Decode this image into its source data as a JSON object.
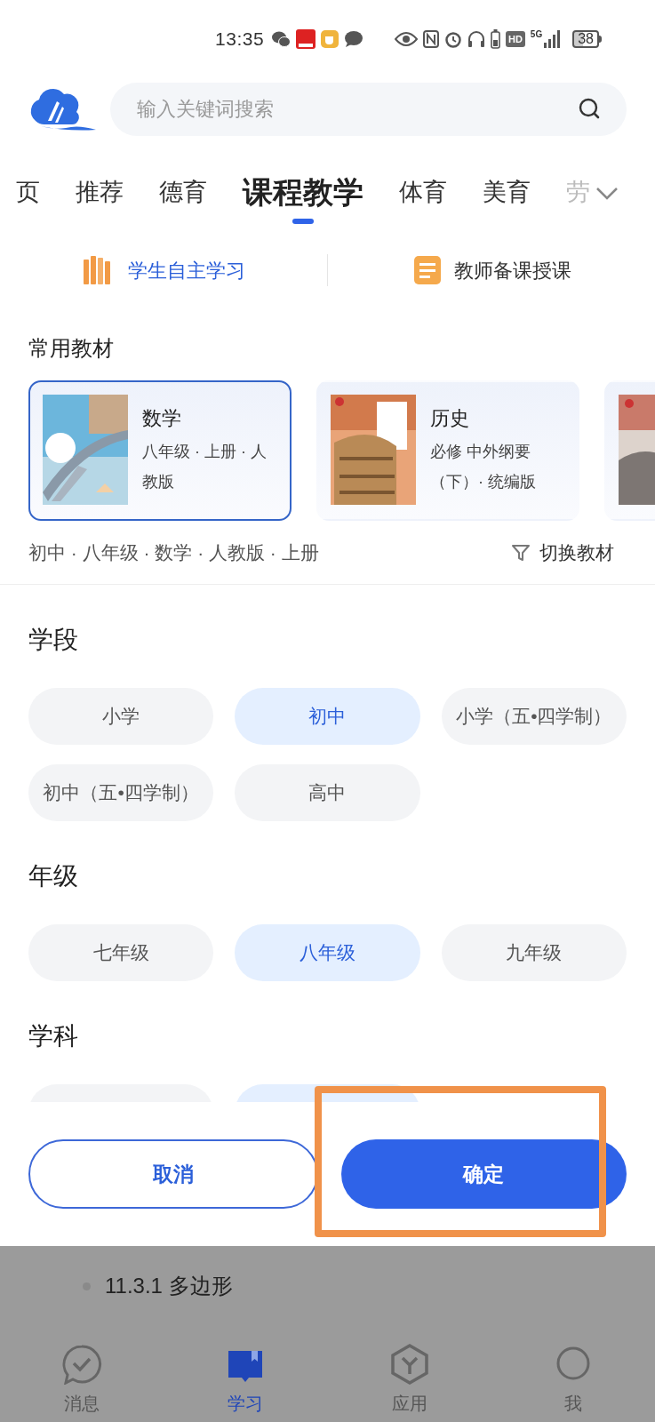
{
  "status_bar": {
    "time": "13:35",
    "hd": "HD",
    "network": "5G",
    "battery": "38"
  },
  "search": {
    "placeholder": "输入关键词搜索"
  },
  "tabs": [
    {
      "label": "页",
      "selected": false,
      "faded": false
    },
    {
      "label": "推荐",
      "selected": false,
      "faded": false
    },
    {
      "label": "德育",
      "selected": false,
      "faded": false
    },
    {
      "label": "课程教学",
      "selected": true,
      "faded": false
    },
    {
      "label": "体育",
      "selected": false,
      "faded": false
    },
    {
      "label": "美育",
      "selected": false,
      "faded": false
    },
    {
      "label": "劳",
      "selected": false,
      "faded": true
    }
  ],
  "modes": [
    {
      "label": "学生自主学习",
      "selected": true
    },
    {
      "label": "教师备课授课",
      "selected": false
    }
  ],
  "textbooks_title": "常用教材",
  "textbooks": [
    {
      "title": "数学",
      "details": "八年级 · 上册 · 人教版",
      "selected": true
    },
    {
      "title": "历史",
      "details": "必修 中外纲要（下）· 统编版",
      "selected": false
    },
    {
      "selected": false
    }
  ],
  "current_textbook": "初中 · 八年级 · 数学 · 人教版 · 上册",
  "switch_label": "切换教材",
  "groups": [
    {
      "title": "学段",
      "options": [
        {
          "label": "小学",
          "selected": false
        },
        {
          "label": "初中",
          "selected": true
        },
        {
          "label": "小学（五•四学制）",
          "selected": false
        },
        {
          "label": "初中（五•四学制）",
          "selected": false
        },
        {
          "label": "高中",
          "selected": false
        }
      ]
    },
    {
      "title": "年级",
      "options": [
        {
          "label": "七年级",
          "selected": false
        },
        {
          "label": "八年级",
          "selected": true
        },
        {
          "label": "九年级",
          "selected": false
        }
      ]
    },
    {
      "title": "学科",
      "options": [
        {
          "selected": false
        },
        {
          "selected": true
        }
      ]
    }
  ],
  "cancel_button": "取消",
  "confirm_button": {
    "label": "确定",
    "highlighted": true
  },
  "background_item": "11.3.1 多边形",
  "bottom_nav": [
    {
      "label": "消息",
      "selected": false
    },
    {
      "label": "学习",
      "selected": true
    },
    {
      "label": "应用",
      "selected": false
    },
    {
      "label": "我",
      "selected": false
    }
  ]
}
